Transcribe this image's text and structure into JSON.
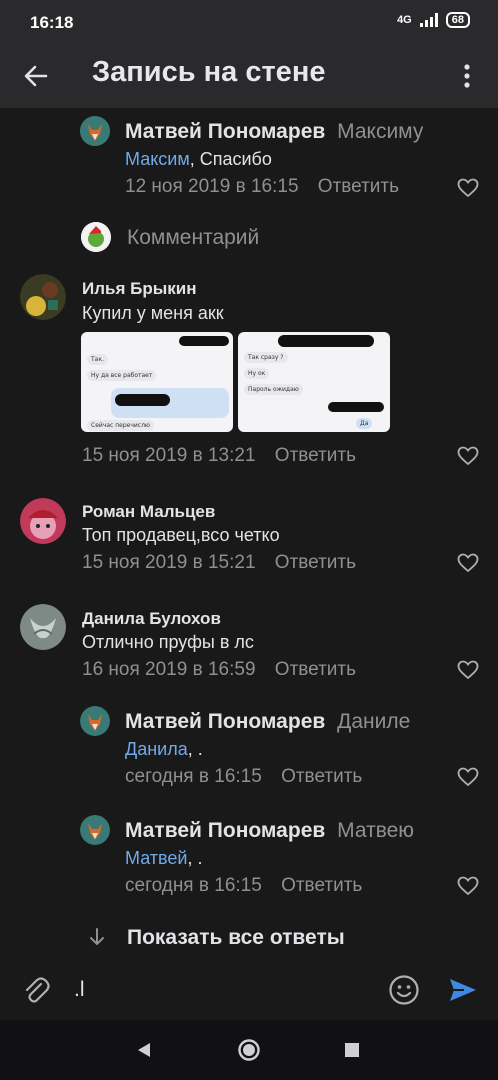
{
  "status": {
    "time": "16:18",
    "network": "4G",
    "battery": "68"
  },
  "header": {
    "title": "Запись на стене"
  },
  "thread": [
    {
      "author": "Матвей Пономарев",
      "reply_to": "Максиму",
      "mention": "Максим",
      "text": ", Спасибо",
      "date": "12 ноя 2019 в 16:15",
      "reply_label": "Ответить"
    }
  ],
  "comment_marker": {
    "label": "Комментарий"
  },
  "comments": [
    {
      "author": "Илья Брыкин",
      "text": "Купил у меня акк",
      "date": "15 ноя 2019 в 13:21",
      "reply_label": "Ответить"
    },
    {
      "author": "Роман Мальцев",
      "text": "Топ продавец,всо четко",
      "date": "15 ноя 2019 в 15:21",
      "reply_label": "Ответить"
    },
    {
      "author": "Данила Булохов",
      "text": "Отлично пруфы в лс",
      "date": "16 ноя 2019 в 16:59",
      "reply_label": "Ответить"
    }
  ],
  "attachment_texts": {
    "a1": "Так.",
    "a2": "Ну да все работает",
    "a3": "Сейчас перечислю",
    "b1": "Так сразу ?",
    "b2": "Ну ок",
    "b3": "Пароль ожидаю",
    "b4": "Да"
  },
  "replies": [
    {
      "author": "Матвей Пономарев",
      "reply_to": "Даниле",
      "mention": "Данила",
      "text": ", .",
      "date": "сегодня в 16:15",
      "reply_label": "Ответить"
    },
    {
      "author": "Матвей Пономарев",
      "reply_to": "Матвею",
      "mention": "Матвей",
      "text": ", .",
      "date": "сегодня в 16:15",
      "reply_label": "Ответить"
    }
  ],
  "show_all": {
    "label": "Показать все ответы"
  },
  "composer": {
    "value": ".l"
  },
  "colors": {
    "accent": "#71aaeb",
    "send": "#3f8ae0",
    "background": "#19191a"
  }
}
